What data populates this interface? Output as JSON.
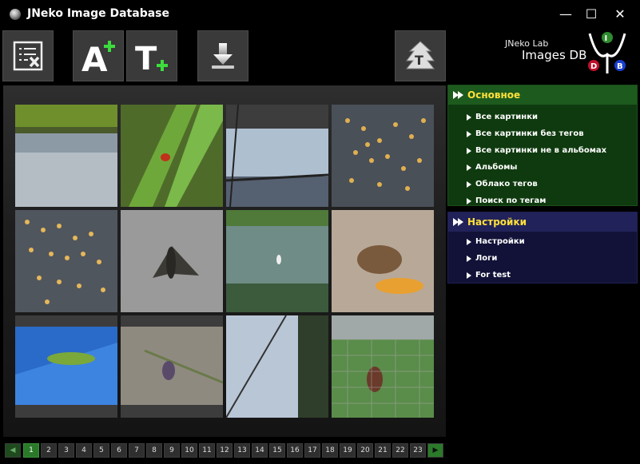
{
  "window": {
    "title": "JNeko Image Database",
    "min_glyph": "—",
    "max_glyph": "☐",
    "close_glyph": "✕"
  },
  "toolbar": {
    "buttons": [
      {
        "name": "clear-selection-button",
        "icon": "list-delete-icon"
      },
      {
        "name": "add-album-button",
        "icon": "letter-a-plus-icon",
        "glyph": "A"
      },
      {
        "name": "add-tag-button",
        "icon": "letter-t-plus-icon",
        "glyph": "T"
      },
      {
        "name": "import-button",
        "icon": "download-arrow-icon"
      },
      {
        "name": "tag-tree-button",
        "icon": "tree-t-icon",
        "glyph": "T"
      }
    ]
  },
  "logo": {
    "line1": "JNeko Lab",
    "line2": "Images DB",
    "letters": [
      "I",
      "D",
      "B"
    ],
    "colors": {
      "I": "#2e8b2e",
      "D": "#c0102a",
      "B": "#1a3fd0"
    }
  },
  "sidebar": {
    "main": {
      "title": "Основное",
      "items": [
        "Все картинки",
        "Все картинки без тегов",
        "Все картинки не в альбомах",
        "Альбомы",
        "Облако тегов",
        "Поиск по тегам"
      ]
    },
    "settings": {
      "title": "Настройки",
      "items": [
        "Настройки",
        "Логи",
        "For test"
      ]
    }
  },
  "gallery": {
    "images": [
      {
        "name": "thumb-pond-reflection"
      },
      {
        "name": "thumb-ladybug-leaf"
      },
      {
        "name": "thumb-sky-wires"
      },
      {
        "name": "thumb-insect-swarm-1"
      },
      {
        "name": "thumb-insect-swarm-2"
      },
      {
        "name": "thumb-moth"
      },
      {
        "name": "thumb-pond-bird"
      },
      {
        "name": "thumb-mouse"
      },
      {
        "name": "thumb-grasshopper"
      },
      {
        "name": "thumb-bug-ground"
      },
      {
        "name": "thumb-sky-wires-2"
      },
      {
        "name": "thumb-bug-net"
      }
    ]
  },
  "pager": {
    "prev": "◀",
    "next": "▶",
    "current": 1,
    "pages": [
      "1",
      "2",
      "3",
      "4",
      "5",
      "6",
      "7",
      "8",
      "9",
      "10",
      "11",
      "12",
      "13",
      "14",
      "15",
      "16",
      "17",
      "18",
      "19",
      "20",
      "21",
      "22",
      "23"
    ]
  }
}
